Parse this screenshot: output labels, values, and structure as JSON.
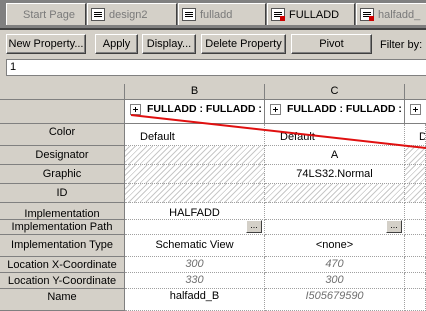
{
  "tabs": [
    {
      "label": "Start Page"
    },
    {
      "label": "design2"
    },
    {
      "label": "fulladd"
    },
    {
      "label": "FULLADD"
    },
    {
      "label": "halfadd_"
    }
  ],
  "toolbar": {
    "new_property": "New Property...",
    "apply": "Apply",
    "display": "Display...",
    "delete_property": "Delete Property",
    "pivot": "Pivot",
    "filter_label": "Filter by:"
  },
  "edit_value": "1",
  "grid": {
    "columns": [
      "B",
      "C"
    ],
    "component_headers": [
      "FULLADD : FULLADD :",
      "FULLADD : FULLADD :"
    ],
    "rows": [
      {
        "label": "Color",
        "b": "Default",
        "c": "Default",
        "d": "D"
      },
      {
        "label": "Designator",
        "b": "",
        "c": "A",
        "d": ""
      },
      {
        "label": "Graphic",
        "b": "",
        "c": "74LS32.Normal",
        "d": ""
      },
      {
        "label": "ID",
        "b": "",
        "c": "",
        "d": ""
      },
      {
        "label": "Implementation",
        "b": "HALFADD",
        "c": "",
        "d": ""
      },
      {
        "label": "Implementation Path",
        "b": "",
        "c": "",
        "d": ""
      },
      {
        "label": "Implementation Type",
        "b": "Schematic View",
        "c": "<none>",
        "d": ""
      },
      {
        "label": "Location X-Coordinate",
        "b": "300",
        "c": "470",
        "d": ""
      },
      {
        "label": "Location Y-Coordinate",
        "b": "330",
        "c": "300",
        "d": ""
      },
      {
        "label": "Name",
        "b": "halfadd_B",
        "c": "I505679590",
        "d": ""
      }
    ],
    "ellipsis": "..."
  },
  "colors": {
    "annotation_line": "#e01010",
    "chrome": "#d4d0c8"
  }
}
